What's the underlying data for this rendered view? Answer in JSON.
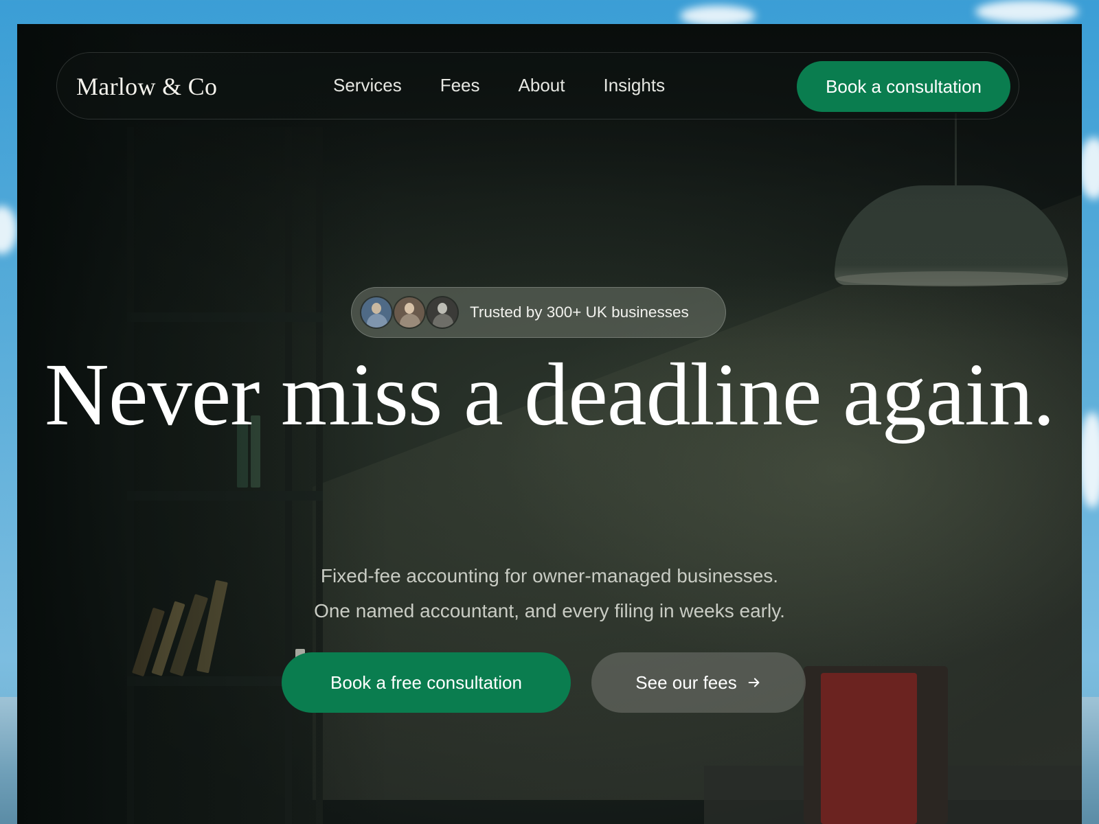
{
  "brand": {
    "name": "Marlow & Co"
  },
  "nav": {
    "links": [
      "Services",
      "Fees",
      "About",
      "Insights"
    ],
    "cta_label": "Book a consultation"
  },
  "badge": {
    "text": "Trusted by 300+ UK businesses",
    "avatars": [
      "avatar-1",
      "avatar-2",
      "avatar-3"
    ]
  },
  "hero": {
    "title": "Never miss a deadline again.",
    "subtitle_line1": "Fixed-fee accounting for owner-managed businesses.",
    "subtitle_line2": "One named accountant, and every filing in weeks early.",
    "primary_cta": "Book a free consultation",
    "secondary_cta": "See our fees",
    "secondary_icon": "arrow-right-icon"
  },
  "colors": {
    "accent_green": "#0a7d4f",
    "text_primary": "#ffffff",
    "text_muted": "#c9ccc4"
  }
}
